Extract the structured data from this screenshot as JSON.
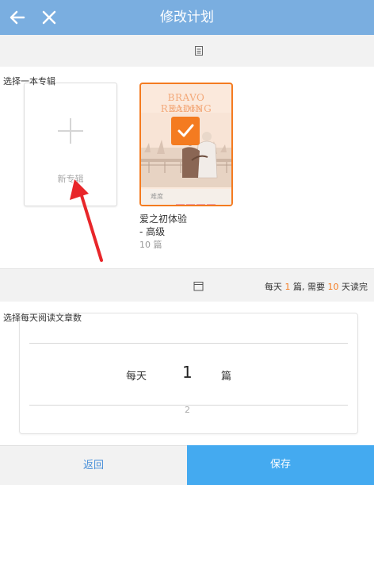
{
  "header": {
    "title": "修改计划",
    "back_icon": "arrow-left-icon",
    "close_icon": "close-icon"
  },
  "album_section": {
    "label": "选择一本专辑",
    "new_album_label": "新专辑",
    "book": {
      "cover_title": "BRAVO READING",
      "cover_subtitle": "爱之初体验",
      "difficulty_label": "难度",
      "difficulty_level": 4,
      "difficulty_max": 5,
      "name": "爱之初体验",
      "level": "- 高级",
      "count": "10 篇",
      "selected": true
    }
  },
  "plan_bar": {
    "summary_prefix": "每天 ",
    "per_day": "1",
    "summary_mid": " 篇, 需要 ",
    "days": "10",
    "summary_suffix": " 天读完"
  },
  "picker_section": {
    "label": "选择每天阅读文章数",
    "per": "每天",
    "value": "1",
    "unit": "篇",
    "next_value": "2"
  },
  "footer": {
    "back_label": "返回",
    "save_label": "保存"
  },
  "colors": {
    "header": "#7aaee0",
    "accent": "#f47b20",
    "save": "#44aaf0",
    "back_text": "#4a90d9"
  }
}
